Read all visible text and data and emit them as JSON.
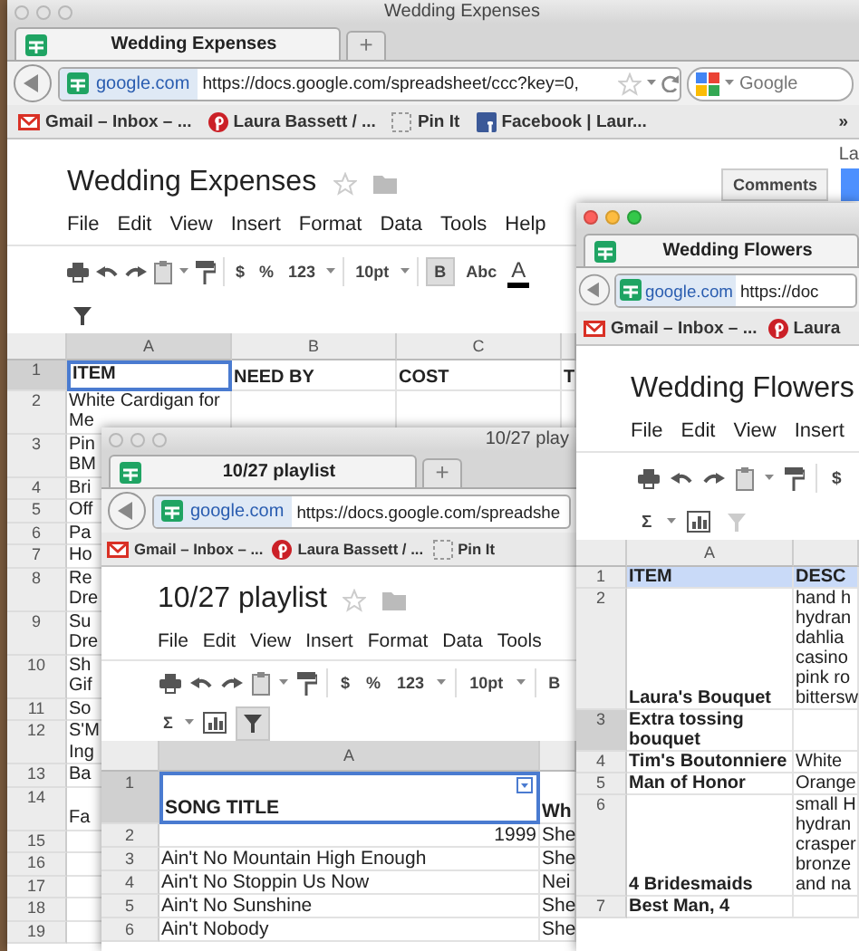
{
  "windows": [
    {
      "title": "Wedding Expenses",
      "active": false,
      "tab": "Wedding Expenses",
      "new_tab": "+",
      "domain": "google.com",
      "url": "https://docs.google.com/spreadsheet/ccc?key=0,",
      "url_icons": true,
      "search": {
        "placeholder": "Google"
      },
      "bookmarks": [
        {
          "kind": "mail",
          "label": "Gmail – Inbox – ..."
        },
        {
          "kind": "pin",
          "label": "Laura Bassett / ..."
        },
        {
          "kind": "dashed",
          "label": "Pin It"
        },
        {
          "kind": "social",
          "label": "Facebook | Laur..."
        },
        {
          "kind": "more",
          "label": "»"
        }
      ],
      "doc_title": "Wedding Expenses",
      "starred": false,
      "folder": true,
      "account": "La",
      "comments": "Comments",
      "menu": [
        "File",
        "Edit",
        "View",
        "Insert",
        "Format",
        "Data",
        "Tools",
        "Help"
      ],
      "toolbar": [
        {
          "kind": "print"
        },
        {
          "kind": "undo"
        },
        {
          "kind": "redo"
        },
        {
          "kind": "paste"
        },
        {
          "kind": "caret"
        },
        {
          "kind": "paint"
        },
        {
          "kind": "sep"
        },
        {
          "kind": "text",
          "text": "$",
          "on": false
        },
        {
          "kind": "text",
          "text": "%",
          "on": false
        },
        {
          "kind": "text",
          "text": "123",
          "on": false
        },
        {
          "kind": "caret"
        },
        {
          "kind": "sep"
        },
        {
          "kind": "text",
          "text": "10pt",
          "on": false
        },
        {
          "kind": "caret"
        },
        {
          "kind": "sep"
        },
        {
          "kind": "text",
          "text": "B",
          "on": true
        },
        {
          "kind": "text",
          "text": "Abc",
          "on": false
        },
        {
          "kind": "color",
          "text": "A"
        }
      ],
      "toolbar2": [
        {
          "kind": "filter",
          "on": false,
          "disabled": false
        }
      ],
      "sheet": {
        "columns": [
          {
            "label": "A",
            "selected": true
          },
          {
            "label": "B",
            "selected": false
          },
          {
            "label": "C",
            "selected": false
          },
          {
            "selected": false
          }
        ],
        "rows": [
          {
            "number": "1",
            "selected": true,
            "cells": [
              {
                "text": "ITEM",
                "bold": true,
                "selected": true
              },
              {
                "text": "NEED BY",
                "bold": true
              },
              {
                "text": "COST",
                "bold": true
              },
              {
                "text": "T",
                "bold": true
              }
            ]
          },
          {
            "number": "2",
            "selected": false,
            "cells": [
              {
                "text": "White Cardigan for\nMe"
              }
            ]
          },
          {
            "number": "3",
            "selected": false,
            "cells": [
              {
                "text": "Pin\nBM"
              }
            ]
          },
          {
            "number": "4",
            "selected": false,
            "cells": [
              {
                "text": "Bri"
              }
            ]
          },
          {
            "number": "5",
            "selected": false,
            "cells": [
              {
                "text": "Off"
              }
            ]
          },
          {
            "number": "6",
            "selected": false,
            "cells": [
              {
                "text": "Pa"
              }
            ]
          },
          {
            "number": "7",
            "selected": false,
            "cells": [
              {
                "text": "Ho"
              }
            ]
          },
          {
            "number": "8",
            "selected": false,
            "cells": [
              {
                "text": "Re\nDre"
              }
            ]
          },
          {
            "number": "9",
            "selected": false,
            "cells": [
              {
                "text": "Su\nDre"
              }
            ]
          },
          {
            "number": "10",
            "selected": false,
            "cells": [
              {
                "text": "Sh\nGif"
              }
            ]
          },
          {
            "number": "11",
            "selected": false,
            "cells": [
              {
                "text": "So"
              }
            ]
          },
          {
            "number": "12",
            "selected": false,
            "cells": [
              {
                "text": "S'M\nIng"
              }
            ]
          },
          {
            "number": "13",
            "selected": false,
            "cells": [
              {
                "text": "Ba"
              }
            ]
          },
          {
            "number": "14",
            "selected": false,
            "cells": [
              {
                "text": "\nFa"
              }
            ]
          },
          {
            "number": "15",
            "selected": false,
            "cells": []
          },
          {
            "number": "16",
            "selected": false,
            "cells": []
          },
          {
            "number": "17",
            "selected": false,
            "cells": []
          },
          {
            "number": "18",
            "selected": false,
            "cells": []
          },
          {
            "number": "19",
            "selected": false,
            "cells": []
          }
        ]
      }
    },
    {
      "title": "10/27 play",
      "active": false,
      "tab": "10/27 playlist",
      "new_tab": "+",
      "domain": "google.com",
      "url": "https://docs.google.com/spreadshe",
      "url_icons": false,
      "bookmarks": [
        {
          "kind": "mail",
          "label": "Gmail – Inbox – ..."
        },
        {
          "kind": "pin",
          "label": "Laura Bassett / ..."
        },
        {
          "kind": "dashed",
          "label": "Pin It"
        }
      ],
      "doc_title": "10/27 playlist",
      "starred": false,
      "folder": true,
      "menu": [
        "File",
        "Edit",
        "View",
        "Insert",
        "Format",
        "Data",
        "Tools"
      ],
      "toolbar": [
        {
          "kind": "print"
        },
        {
          "kind": "undo"
        },
        {
          "kind": "redo"
        },
        {
          "kind": "paste"
        },
        {
          "kind": "caret"
        },
        {
          "kind": "paint"
        },
        {
          "kind": "sep"
        },
        {
          "kind": "text",
          "text": "$",
          "on": false
        },
        {
          "kind": "text",
          "text": "%",
          "on": false
        },
        {
          "kind": "text",
          "text": "123",
          "on": false
        },
        {
          "kind": "caret"
        },
        {
          "kind": "sep"
        },
        {
          "kind": "text",
          "text": "10pt",
          "on": false
        },
        {
          "kind": "caret"
        },
        {
          "kind": "sep"
        },
        {
          "kind": "text",
          "text": "B",
          "on": false
        }
      ],
      "toolbar2": [
        {
          "kind": "text",
          "text": "Σ",
          "on": false
        },
        {
          "kind": "caret"
        },
        {
          "kind": "chart"
        },
        {
          "kind": "filter",
          "on": true,
          "disabled": false
        }
      ],
      "sheet": {
        "columns": [
          {
            "label": "A",
            "selected": true
          },
          {
            "selected": false
          }
        ],
        "rows": [
          {
            "number": "1",
            "selected": true,
            "cells": [
              {
                "text": "\nSONG TITLE",
                "bold": true,
                "selected": true,
                "filter": true
              },
              {
                "text": "\nWh",
                "bold": true
              }
            ]
          },
          {
            "number": "2",
            "selected": false,
            "cells": [
              {
                "text": "1999",
                "numeric": true
              },
              {
                "text": "She"
              }
            ]
          },
          {
            "number": "3",
            "selected": false,
            "cells": [
              {
                "text": "Ain't No Mountain High Enough"
              },
              {
                "text": "She"
              }
            ]
          },
          {
            "number": "4",
            "selected": false,
            "cells": [
              {
                "text": "Ain't No Stoppin Us Now"
              },
              {
                "text": "Nei"
              }
            ]
          },
          {
            "number": "5",
            "selected": false,
            "cells": [
              {
                "text": "Ain't No Sunshine"
              },
              {
                "text": "She"
              }
            ]
          },
          {
            "number": "6",
            "selected": false,
            "cells": [
              {
                "text": "Ain't Nobody"
              },
              {
                "text": "She"
              }
            ]
          }
        ]
      }
    },
    {
      "active": true,
      "tab": "Wedding Flowers",
      "domain": "google.com",
      "url": "https://doc",
      "url_icons": false,
      "bookmarks": [
        {
          "kind": "mail",
          "label": "Gmail – Inbox – ..."
        },
        {
          "kind": "pin",
          "label": "Laura"
        }
      ],
      "doc_title": "Wedding Flowers",
      "menu": [
        "File",
        "Edit",
        "View",
        "Insert"
      ],
      "toolbar": [
        {
          "kind": "print"
        },
        {
          "kind": "undo"
        },
        {
          "kind": "redo"
        },
        {
          "kind": "paste"
        },
        {
          "kind": "caret"
        },
        {
          "kind": "paint"
        },
        {
          "kind": "sep"
        },
        {
          "kind": "text",
          "text": "$",
          "on": false
        }
      ],
      "toolbar2": [
        {
          "kind": "text",
          "text": "Σ",
          "on": false
        },
        {
          "kind": "caret"
        },
        {
          "kind": "chart"
        },
        {
          "kind": "filter",
          "on": false,
          "disabled": true
        }
      ],
      "sheet": {
        "columns": [
          {
            "label": "A",
            "selected": false
          },
          {
            "selected": false
          }
        ],
        "rows": [
          {
            "number": "1",
            "selected": false,
            "highlighted": true,
            "cells": [
              {
                "text": "ITEM",
                "bold": true
              },
              {
                "text": "DESC",
                "bold": true
              }
            ]
          },
          {
            "number": "2",
            "selected": false,
            "cells": [
              {
                "text": "\n\n\n\n\nLaura's Bouquet",
                "bold": true
              },
              {
                "text": "hand h\nhydran\ndahlia\ncasino\npink ro\nbittersw"
              }
            ]
          },
          {
            "number": "3",
            "selected": true,
            "cells": [
              {
                "text": "Extra tossing\nbouquet",
                "bold": true
              }
            ]
          },
          {
            "number": "4",
            "selected": false,
            "cells": [
              {
                "text": "Tim's Boutonniere",
                "bold": true
              },
              {
                "text": "White"
              }
            ]
          },
          {
            "number": "5",
            "selected": false,
            "cells": [
              {
                "text": "Man of Honor",
                "bold": true
              },
              {
                "text": "Orange"
              }
            ]
          },
          {
            "number": "6",
            "selected": false,
            "cells": [
              {
                "text": "\n\n\n\n4 Bridesmaids",
                "bold": true
              },
              {
                "text": "small H\nhydran\ncrasper\nbronze\nand na"
              }
            ]
          },
          {
            "number": "7",
            "selected": false,
            "cells": [
              {
                "text": "Best Man, 4",
                "bold": true
              }
            ]
          }
        ]
      }
    }
  ]
}
